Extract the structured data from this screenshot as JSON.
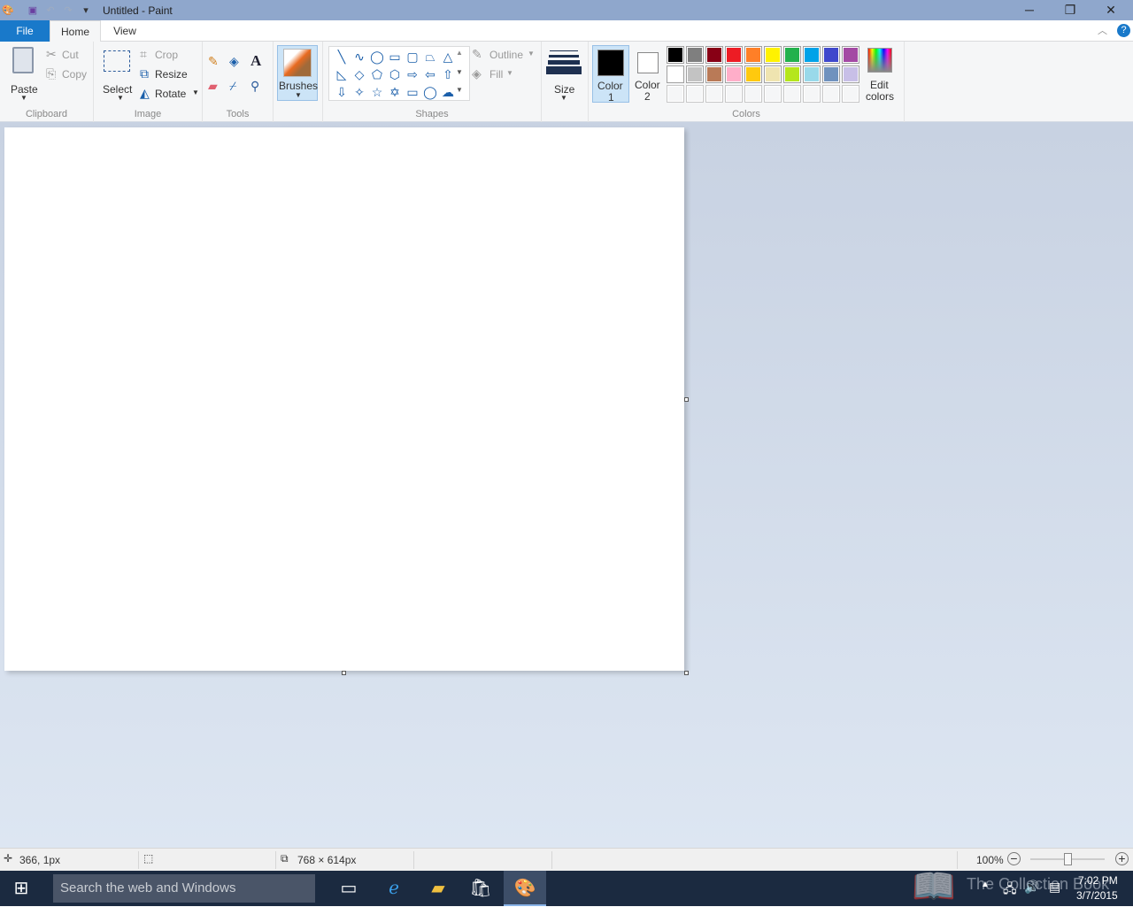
{
  "window": {
    "title": "Untitled - Paint",
    "minimize": "─",
    "restore": "❐",
    "close": "✕"
  },
  "tabs": [
    {
      "label": "File"
    },
    {
      "label": "Home"
    },
    {
      "label": "View"
    }
  ],
  "clipboard": {
    "paste": "Paste",
    "cut": "Cut",
    "copy": "Copy",
    "group": "Clipboard"
  },
  "image": {
    "select": "Select",
    "crop": "Crop",
    "resize": "Resize",
    "rotate": "Rotate",
    "group": "Image"
  },
  "tools": {
    "group": "Tools"
  },
  "brushes": {
    "label": "Brushes"
  },
  "shapes": {
    "group": "Shapes",
    "outline": "Outline",
    "fill": "Fill",
    "items": [
      "╲",
      "∿",
      "◯",
      "▭",
      "▢",
      "⏢",
      "△",
      "◺",
      "◇",
      "⬠",
      "⬡",
      "⇨",
      "⇦",
      "⇧",
      "⇩",
      "✧",
      "☆",
      "✡",
      "▭",
      "◯",
      "☁"
    ]
  },
  "size": {
    "label": "Size"
  },
  "colors": {
    "color1_label": "Color",
    "color1_num": "1",
    "color2_label": "Color",
    "color2_num": "2",
    "color1": "#000000",
    "color2": "#ffffff",
    "edit": "Edit",
    "edit2": "colors",
    "group": "Colors",
    "palette_row1": [
      "#000000",
      "#7f7f7f",
      "#880015",
      "#ed1c24",
      "#ff7f27",
      "#fff200",
      "#22b14c",
      "#00a2e8",
      "#3f48cc",
      "#a349a4"
    ],
    "palette_row2": [
      "#ffffff",
      "#c3c3c3",
      "#b97a57",
      "#ffaec9",
      "#ffc90e",
      "#efe4b0",
      "#b5e61d",
      "#99d9ea",
      "#7092be",
      "#c8bfe7"
    ]
  },
  "status": {
    "cursor": "366, 1px",
    "size": "768 × 614px",
    "zoom": "100%"
  },
  "taskbar": {
    "search_placeholder": "Search the web and Windows",
    "time": "7:02 PM",
    "date": "3/7/2015",
    "watermark": "The Collection Book"
  }
}
